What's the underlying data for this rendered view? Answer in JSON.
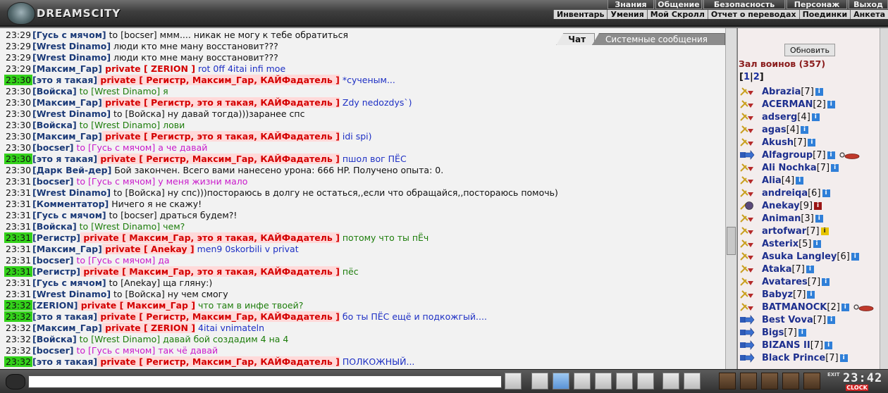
{
  "brand": {
    "logo_text": "DREAMSCITY"
  },
  "top_nav": [
    "Знания",
    "Общение",
    "Безопасность",
    "Персонаж",
    "Выход"
  ],
  "sub_nav": [
    "Инвентарь",
    "Умения",
    "Мой Скролл",
    "Отчет о переводах",
    "Поединки",
    "Анкета"
  ],
  "tabs": {
    "chat": "Чат",
    "system": "Системные сообщения"
  },
  "chat_lines": [
    {
      "time": "23:29",
      "hl": false,
      "parts": [
        {
          "t": "[Гусь с мячом]",
          "c": "nick"
        },
        {
          "t": " to [bocser] ммм.... никак не могу к тебе обратиться",
          "c": "msg-black"
        }
      ]
    },
    {
      "time": "23:29",
      "hl": false,
      "parts": [
        {
          "t": "[Wrest Dinamo]",
          "c": "nick"
        },
        {
          "t": " люди кто мне ману восстановит???",
          "c": "msg-black"
        }
      ]
    },
    {
      "time": "23:29",
      "hl": false,
      "parts": [
        {
          "t": "[Wrest Dinamo]",
          "c": "nick"
        },
        {
          "t": " люди кто мне ману восстановит???",
          "c": "msg-black"
        }
      ]
    },
    {
      "time": "23:29",
      "hl": false,
      "parts": [
        {
          "t": "[Максим_Гар]",
          "c": "nick"
        },
        {
          "t": " private [ ZERION ]",
          "c": "priv"
        },
        {
          "t": " rot 0ff 4itai infi moe",
          "c": "msg-blue"
        }
      ]
    },
    {
      "time": "23:30",
      "hl": true,
      "parts": [
        {
          "t": "[это я такая]",
          "c": "nick"
        },
        {
          "t": " private [ Регистр, Максим_Гар, КАЙФадатель ]",
          "c": "priv priv-bg"
        },
        {
          "t": " *сученым...",
          "c": "msg-blue"
        }
      ]
    },
    {
      "time": "23:30",
      "hl": false,
      "parts": [
        {
          "t": "[Войска]",
          "c": "nick"
        },
        {
          "t": " to [Wrest Dinamo] я",
          "c": "msg-green"
        }
      ]
    },
    {
      "time": "23:30",
      "hl": false,
      "parts": [
        {
          "t": "[Максим_Гар]",
          "c": "nick"
        },
        {
          "t": " private [ Регистр, это я такая, КАЙФадатель ]",
          "c": "priv priv-bg"
        },
        {
          "t": " Zdy nedozdys`)",
          "c": "msg-blue"
        }
      ]
    },
    {
      "time": "23:30",
      "hl": false,
      "parts": [
        {
          "t": "[Wrest Dinamo]",
          "c": "nick"
        },
        {
          "t": " to [Войска] ну давай тогда)))заранее спс",
          "c": "msg-black"
        }
      ]
    },
    {
      "time": "23:30",
      "hl": false,
      "parts": [
        {
          "t": "[Войска]",
          "c": "nick"
        },
        {
          "t": " to [Wrest Dinamo] лови",
          "c": "msg-green"
        }
      ]
    },
    {
      "time": "23:30",
      "hl": false,
      "parts": [
        {
          "t": "[Максим_Гар]",
          "c": "nick"
        },
        {
          "t": " private [ Регистр, это я такая, КАЙФадатель ]",
          "c": "priv priv-bg"
        },
        {
          "t": " idi spi)",
          "c": "msg-blue"
        }
      ]
    },
    {
      "time": "23:30",
      "hl": false,
      "parts": [
        {
          "t": "[bocser]",
          "c": "nick"
        },
        {
          "t": " to [Гусь с мячом] а че давай",
          "c": "msg-magenta"
        }
      ]
    },
    {
      "time": "23:30",
      "hl": true,
      "parts": [
        {
          "t": "[это я такая]",
          "c": "nick"
        },
        {
          "t": " private [ Регистр, Максим_Гар, КАЙФадатель ]",
          "c": "priv priv-bg"
        },
        {
          "t": " пшол вог ПЁС",
          "c": "msg-blue"
        }
      ]
    },
    {
      "time": "23:30",
      "hl": false,
      "parts": [
        {
          "t": "[Дарк Вей-дер]",
          "c": "nick"
        },
        {
          "t": " Бой закончен. Всего вами нанесено урона: 666 HP. Получено опыта: 0.",
          "c": "msg-black"
        }
      ]
    },
    {
      "time": "23:31",
      "hl": false,
      "parts": [
        {
          "t": "[bocser]",
          "c": "nick"
        },
        {
          "t": " to [Гусь с мячом] у меня жизни мало",
          "c": "msg-magenta"
        }
      ]
    },
    {
      "time": "23:31",
      "hl": false,
      "parts": [
        {
          "t": "[Wrest Dinamo]",
          "c": "nick"
        },
        {
          "t": " to [Войска] ну спс)))постораюсь в долгу не остаться,,если что обращайся,,постораюсь помочь)",
          "c": "msg-black"
        }
      ]
    },
    {
      "time": "23:31",
      "hl": false,
      "parts": [
        {
          "t": "[Комментатор]",
          "c": "nick"
        },
        {
          "t": " Ничего я не скажу!",
          "c": "msg-black"
        }
      ]
    },
    {
      "time": "23:31",
      "hl": false,
      "parts": [
        {
          "t": "[Гусь с мячом]",
          "c": "nick"
        },
        {
          "t": " to [bocser] драться будем?!",
          "c": "msg-black"
        }
      ]
    },
    {
      "time": "23:31",
      "hl": false,
      "parts": [
        {
          "t": "[Войска]",
          "c": "nick"
        },
        {
          "t": " to [Wrest Dinamo] чем?",
          "c": "msg-green"
        }
      ]
    },
    {
      "time": "23:31",
      "hl": true,
      "parts": [
        {
          "t": "[Регистр]",
          "c": "nick"
        },
        {
          "t": " private [ Максим_Гар, это я такая, КАЙФадатель ]",
          "c": "priv priv-bg"
        },
        {
          "t": " потому что ты пЁч",
          "c": "msg-green"
        }
      ]
    },
    {
      "time": "23:31",
      "hl": false,
      "parts": [
        {
          "t": "[Максим_Гар]",
          "c": "nick"
        },
        {
          "t": " private [ Anekay ]",
          "c": "priv priv-bg"
        },
        {
          "t": " men9 0skorbili v privat",
          "c": "msg-blue"
        }
      ]
    },
    {
      "time": "23:31",
      "hl": false,
      "parts": [
        {
          "t": "[bocser]",
          "c": "nick"
        },
        {
          "t": " to [Гусь с мячом] да",
          "c": "msg-magenta"
        }
      ]
    },
    {
      "time": "23:31",
      "hl": true,
      "parts": [
        {
          "t": "[Регистр]",
          "c": "nick"
        },
        {
          "t": " private [ Максим_Гар, это я такая, КАЙФадатель ]",
          "c": "priv priv-bg"
        },
        {
          "t": " пёс",
          "c": "msg-green"
        }
      ]
    },
    {
      "time": "23:31",
      "hl": false,
      "parts": [
        {
          "t": "[Гусь с мячом]",
          "c": "nick"
        },
        {
          "t": " to [Anekay] ща гляну:)",
          "c": "msg-black"
        }
      ]
    },
    {
      "time": "23:31",
      "hl": false,
      "parts": [
        {
          "t": "[Wrest Dinamo]",
          "c": "nick"
        },
        {
          "t": " to [Войска] ну чем смогу",
          "c": "msg-black"
        }
      ]
    },
    {
      "time": "23:32",
      "hl": true,
      "parts": [
        {
          "t": "[ZERION]",
          "c": "nick"
        },
        {
          "t": " private [ Максим_Гар ]",
          "c": "priv priv-bg"
        },
        {
          "t": " что там в инфе твоей?",
          "c": "msg-green"
        }
      ]
    },
    {
      "time": "23:32",
      "hl": true,
      "parts": [
        {
          "t": "[это я такая]",
          "c": "nick"
        },
        {
          "t": " private [ Регистр, Максим_Гар, КАЙФадатель ]",
          "c": "priv priv-bg"
        },
        {
          "t": " бо ты ПЁС ещё и подкожгый....",
          "c": "msg-blue"
        }
      ]
    },
    {
      "time": "23:32",
      "hl": false,
      "parts": [
        {
          "t": "[Максим_Гар]",
          "c": "nick"
        },
        {
          "t": " private [ ZERION ]",
          "c": "priv priv-bg"
        },
        {
          "t": " 4itai vnimateln",
          "c": "msg-blue"
        }
      ]
    },
    {
      "time": "23:32",
      "hl": false,
      "parts": [
        {
          "t": "[Войска]",
          "c": "nick"
        },
        {
          "t": " to [Wrest Dinamo] давай бой создадим 4 на 4",
          "c": "msg-green"
        }
      ]
    },
    {
      "time": "23:32",
      "hl": false,
      "parts": [
        {
          "t": "[bocser]",
          "c": "nick"
        },
        {
          "t": " to [Гусь с мячом] так чё давай",
          "c": "msg-magenta"
        }
      ]
    },
    {
      "time": "23:32",
      "hl": true,
      "parts": [
        {
          "t": "[это я такая]",
          "c": "nick"
        },
        {
          "t": " private [ Регистр, Максим_Гар, КАЙФадатель ]",
          "c": "priv priv-bg"
        },
        {
          "t": " ПОЛКОЖНЫЙ...",
          "c": "msg-blue"
        }
      ]
    }
  ],
  "panel": {
    "refresh_label": "Обновить",
    "hall_title": "Зал воинов (357)",
    "pages": [
      "1",
      "2"
    ],
    "players": [
      {
        "name": "Abrazia",
        "level": "[7]",
        "info": "blue",
        "extra": false,
        "icon": "fight"
      },
      {
        "name": "ACERMAN",
        "level": "[2]",
        "info": "blue",
        "extra": false,
        "icon": "fight"
      },
      {
        "name": "adserg",
        "level": "[4]",
        "info": "blue",
        "extra": false,
        "icon": "fight"
      },
      {
        "name": "agas",
        "level": "[4]",
        "info": "blue",
        "extra": false,
        "icon": "fight"
      },
      {
        "name": "Akush",
        "level": "[7]",
        "info": "blue",
        "extra": false,
        "icon": "fight"
      },
      {
        "name": "Alfagroup",
        "level": "[7]",
        "info": "blue",
        "extra": true,
        "icon": "arrow"
      },
      {
        "name": "Ali Nochka",
        "level": "[7]",
        "info": "blue",
        "extra": false,
        "icon": "fight"
      },
      {
        "name": "Alia",
        "level": "[4]",
        "info": "blue",
        "extra": false,
        "icon": "fight"
      },
      {
        "name": "andreiqa",
        "level": "[6]",
        "info": "blue",
        "extra": false,
        "icon": "fight"
      },
      {
        "name": "Anekay",
        "level": "[9]",
        "info": "red",
        "extra": false,
        "icon": "shield"
      },
      {
        "name": "Animan",
        "level": "[3]",
        "info": "blue",
        "extra": false,
        "icon": "fight"
      },
      {
        "name": "artofwar",
        "level": "[7]",
        "info": "gold",
        "extra": false,
        "icon": "fight"
      },
      {
        "name": "Asterix",
        "level": "[5]",
        "info": "blue",
        "extra": false,
        "icon": "fight"
      },
      {
        "name": "Asuka Langley",
        "level": "[6]",
        "info": "blue",
        "extra": false,
        "icon": "fight"
      },
      {
        "name": "Ataka",
        "level": "[7]",
        "info": "blue",
        "extra": false,
        "icon": "fight"
      },
      {
        "name": "Avatares",
        "level": "[7]",
        "info": "blue",
        "extra": false,
        "icon": "fight"
      },
      {
        "name": "Babyz",
        "level": "[7]",
        "info": "blue",
        "extra": false,
        "icon": "fight"
      },
      {
        "name": "BATMANOCK",
        "level": "[2]",
        "info": "blue",
        "extra": true,
        "icon": "fight"
      },
      {
        "name": "Best Vova",
        "level": "[7]",
        "info": "blue",
        "extra": false,
        "icon": "arrow"
      },
      {
        "name": "Bigs",
        "level": "[7]",
        "info": "blue",
        "extra": false,
        "icon": "arrow"
      },
      {
        "name": "BIZANS II",
        "level": "[7]",
        "info": "blue",
        "extra": false,
        "icon": "arrow"
      },
      {
        "name": "Black Prince",
        "level": "[7]",
        "info": "blue",
        "extra": false,
        "icon": "arrow"
      }
    ]
  },
  "bottom": {
    "input_value": "",
    "clock_time": "23:42",
    "clock_label": "CLOCK",
    "exit_label": "EXIT"
  },
  "colors": {
    "highlight_time": "#33d11a",
    "private": "#d40000",
    "nick": "#1b3a78"
  }
}
